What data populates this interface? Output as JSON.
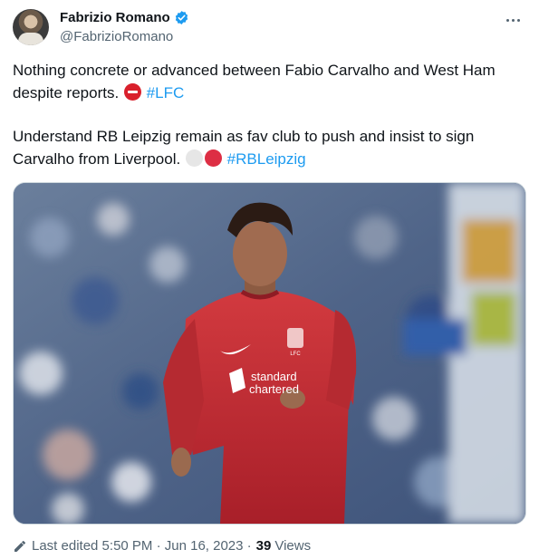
{
  "author": {
    "name": "Fabrizio Romano",
    "handle": "@FabrizioRomano",
    "verified": true
  },
  "icons": {
    "avatar": "profile-photo",
    "verified": "verified-badge-icon",
    "more": "more-options-icon",
    "edit": "pencil-icon",
    "no_entry": "no-entry-emoji",
    "white_circle": "white-circle-emoji",
    "red_circle": "red-circle-emoji"
  },
  "tweet": {
    "line1": "Nothing concrete or advanced between Fabio Carvalho and West Ham despite reports.",
    "hashtag1": "#LFC",
    "line2": "Understand RB Leipzig remain as fav club to push and insist to sign Carvalho from Liverpool.",
    "hashtag2": "#RBLeipzig"
  },
  "media": {
    "sponsor_text_line1": "standard",
    "sponsor_text_line2": "chartered",
    "badge_text": "LFC"
  },
  "footer": {
    "edited": "Last edited 5:50 PM · Jun 16, 2023 ·",
    "views_count": "39",
    "views_label": "Views"
  },
  "colors": {
    "link": "#1d9bf0",
    "verified": "#1d9bf0",
    "secondary_text": "#536471",
    "jersey": "#c62a32"
  }
}
